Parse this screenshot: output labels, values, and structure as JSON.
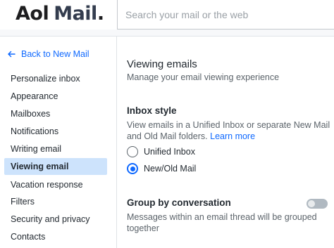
{
  "header": {
    "logo_brand": "Aol",
    "logo_product": "Mail",
    "logo_dot": ".",
    "search_placeholder": "Search your mail or the web"
  },
  "sidebar": {
    "back_label": "Back to New Mail",
    "items": [
      {
        "label": "Personalize inbox",
        "active": false
      },
      {
        "label": "Appearance",
        "active": false
      },
      {
        "label": "Mailboxes",
        "active": false
      },
      {
        "label": "Notifications",
        "active": false
      },
      {
        "label": "Writing email",
        "active": false
      },
      {
        "label": "Viewing email",
        "active": true
      },
      {
        "label": "Vacation response",
        "active": false
      },
      {
        "label": "Filters",
        "active": false
      },
      {
        "label": "Security and privacy",
        "active": false
      },
      {
        "label": "Contacts",
        "active": false
      }
    ]
  },
  "main": {
    "title": "Viewing emails",
    "subtitle": "Manage your email viewing experience",
    "inbox_style": {
      "heading": "Inbox style",
      "description": "View emails in a Unified Inbox or separate New Mail and Old Mail folders.",
      "learn_more": "Learn more",
      "options": [
        {
          "label": "Unified Inbox",
          "selected": false
        },
        {
          "label": "New/Old Mail",
          "selected": true
        }
      ]
    },
    "group_by_conversation": {
      "heading": "Group by conversation",
      "description": "Messages within an email thread will be grouped together",
      "enabled": false
    }
  },
  "colors": {
    "accent": "#0f69ff",
    "active_nav_bg": "#cde3fc",
    "toggle_off": "#b0b9c1"
  }
}
